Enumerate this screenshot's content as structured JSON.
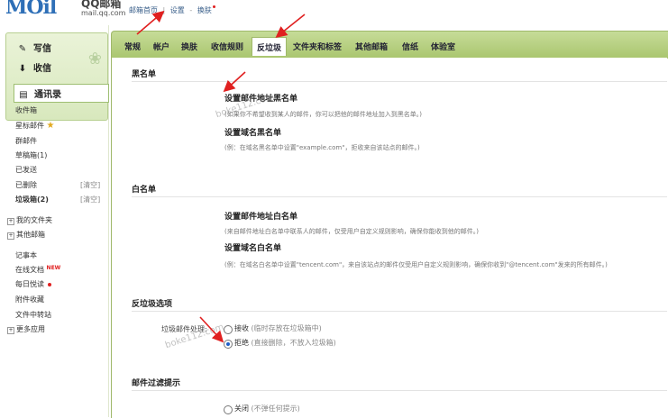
{
  "header": {
    "logo_text": "MOil",
    "logo_qq": "QQ邮箱",
    "logo_domain": "mail.qq.com",
    "nav_home": "邮箱首页",
    "nav_settings": "设置",
    "nav_skin": "换肤",
    "nav_sep": "|",
    "nav_dash": "-"
  },
  "sidebar": {
    "write": "写信",
    "inbox": "收信",
    "contacts": "通讯录",
    "folders": [
      {
        "label": "收件箱"
      },
      {
        "label": "星标邮件"
      },
      {
        "label": "群邮件"
      },
      {
        "label": "草稿箱(1)"
      },
      {
        "label": "已发送"
      },
      {
        "label": "已删除",
        "extra": "[清空]"
      },
      {
        "label": "垃圾箱(2)",
        "extra": "[清空]"
      }
    ],
    "groups": [
      "我的文件夹",
      "其他邮箱"
    ],
    "apps": [
      {
        "label": "记事本"
      },
      {
        "label": "在线文档",
        "badge": "NEW"
      },
      {
        "label": "每日悦读"
      },
      {
        "label": "附件收藏"
      },
      {
        "label": "文件中转站"
      }
    ],
    "more_apps": "更多应用"
  },
  "tabs": [
    "常规",
    "帐户",
    "换肤",
    "收信规则",
    "反垃圾",
    "文件夹和标签",
    "其他邮箱",
    "信纸",
    "体验室"
  ],
  "active_tab": "反垃圾",
  "blacklist": {
    "title": "黑名单",
    "addr_title": "设置邮件地址黑名单",
    "addr_desc": "(如果你不希望收到某人的邮件，你可以把他的邮件地址加入到黑名单。)",
    "domain_title": "设置域名黑名单",
    "domain_desc": "(例：在域名黑名单中设置\"example.com\"，拒收来自该站点的邮件。)"
  },
  "whitelist": {
    "title": "白名单",
    "addr_title": "设置邮件地址白名单",
    "addr_desc": "(来自邮件地址白名单中联系人的邮件，仅受用户自定义规则影响，确保你能收到他的邮件。)",
    "domain_title": "设置域名白名单",
    "domain_desc": "(例：在域名白名单中设置\"tencent.com\"，来自该站点的邮件仅受用户自定义规则影响，确保你收到\"@tencent.com\"发来的所有邮件。)"
  },
  "spam_options": {
    "title": "反垃圾选项",
    "label": "垃圾邮件处理:",
    "options": [
      {
        "label": "接收",
        "note": "(临时存放在垃圾箱中)",
        "selected": false
      },
      {
        "label": "拒绝",
        "note": "(直接删除，不放入垃圾箱)",
        "selected": true
      }
    ]
  },
  "filter_hint": {
    "title": "邮件过滤提示",
    "options": [
      {
        "label": "关闭",
        "note": "(不弹任何提示)",
        "selected": false
      }
    ]
  },
  "watermark": "boke112.com",
  "colors": {
    "accent_green": "#a9c56e",
    "link_blue": "#3a5f8a",
    "arrow_red": "#e02020",
    "radio_blue": "#1e5fc8"
  }
}
